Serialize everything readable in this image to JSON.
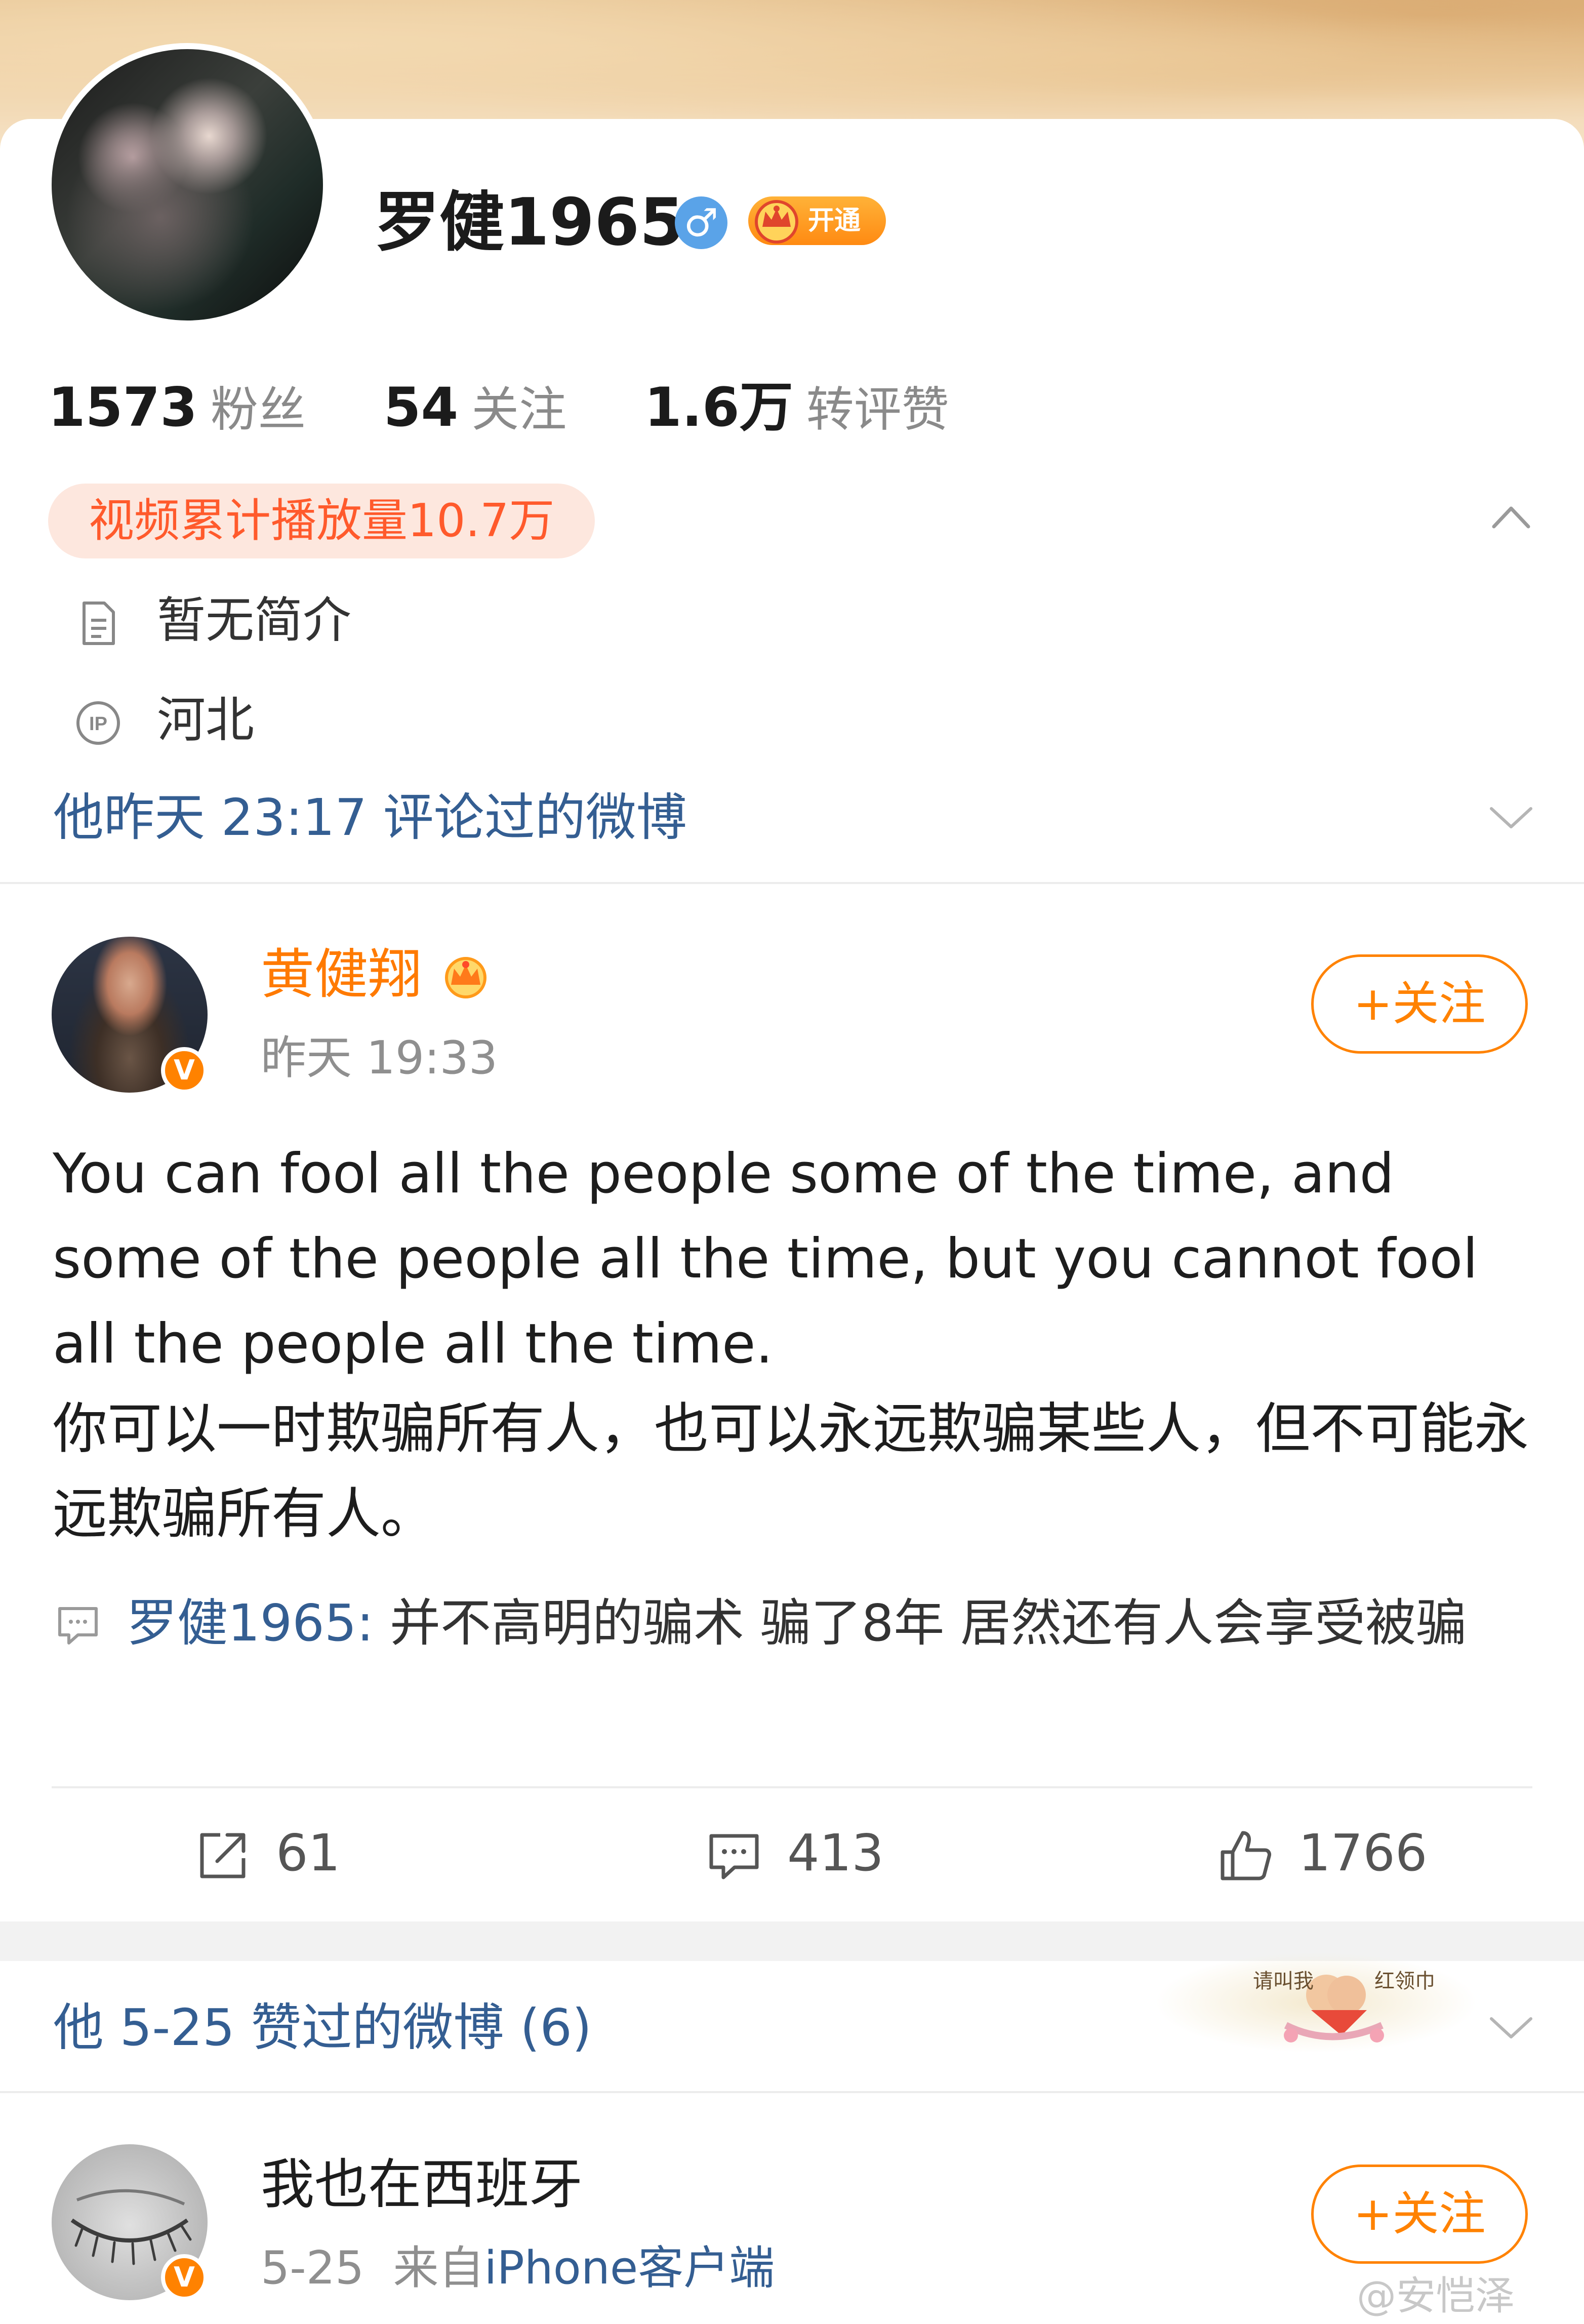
{
  "profile": {
    "name": "罗健1965",
    "gender_symbol": "♂",
    "vip_label": "开通",
    "stats": [
      {
        "value": "1573",
        "label": "粉丝"
      },
      {
        "value": "54",
        "label": "关注"
      },
      {
        "value": "1.6万",
        "label": "转评赞"
      }
    ],
    "video_plays": "视频累计播放量10.7万",
    "bio": "暂无简介",
    "ip_location": "河北"
  },
  "commented_section": {
    "title": "他昨天 23:17 评论过的微博"
  },
  "post": {
    "author": "黄健翔",
    "time": "昨天 19:33",
    "follow_label": "+关注",
    "body_en": "You can fool all the people some of the time, and some of the people all the time, but you cannot fool all the people all the time.",
    "body_zh": "你可以一时欺骗所有人，也可以永远欺骗某些人，但不可能永远欺骗所有人。",
    "comment_user": "罗健1965:",
    "comment_text": " 并不高明的骗术  骗了8年  居然还有人会享受被骗",
    "reposts": "61",
    "comments": "413",
    "likes": "1766"
  },
  "liked_section": {
    "title": "他 5-25 赞过的微博 (6)",
    "decor_left": "请叫我",
    "decor_right": "红领巾"
  },
  "post2": {
    "author": "我也在西班牙",
    "date": "5-25",
    "from_label": "来自",
    "source": "iPhone客户端",
    "follow_label": "+关注"
  },
  "watermark": "@安恺泽",
  "colors": {
    "accent_orange": "#ff8200",
    "link_blue": "#345e92",
    "pill_bg": "#fde7de",
    "pill_text": "#ff5a2c"
  }
}
